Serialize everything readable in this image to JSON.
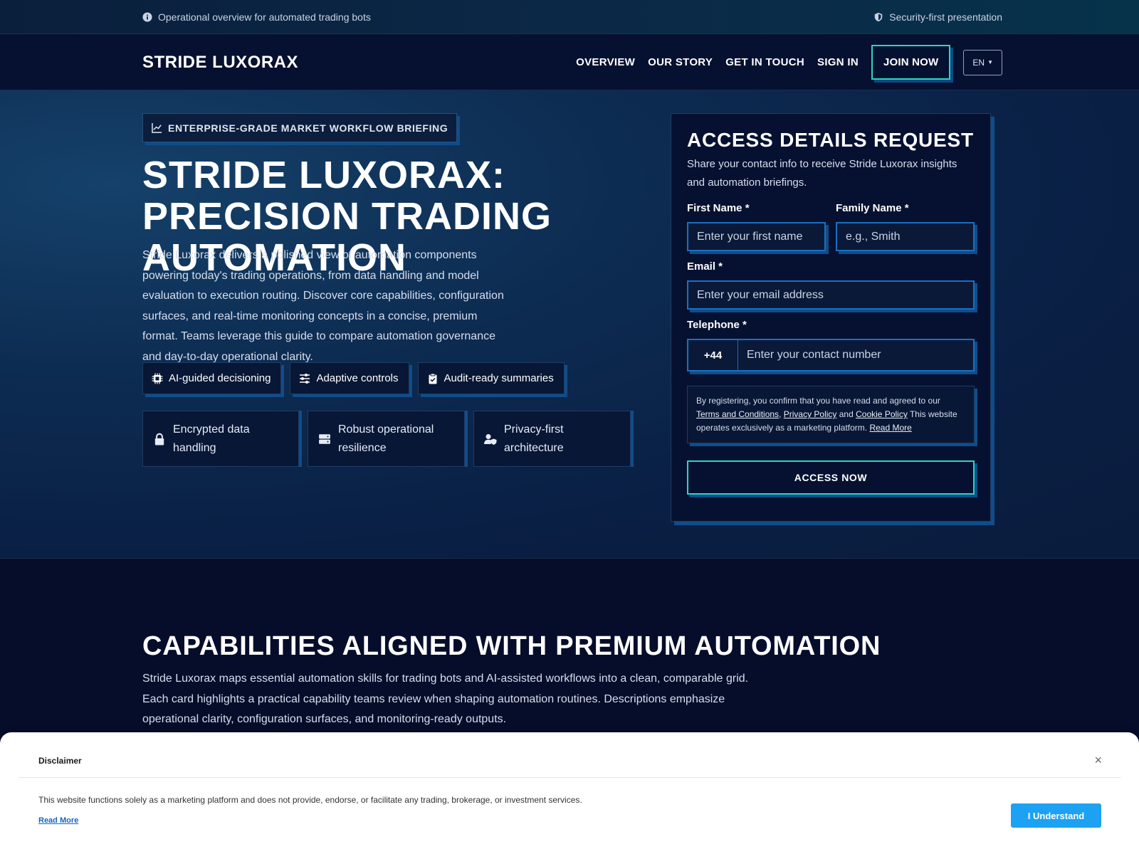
{
  "topstrip": {
    "left_text": "Operational overview for automated trading bots",
    "right_text": "Security-first presentation"
  },
  "nav": {
    "brand": "STRIDE LUXORAX",
    "items": [
      "OVERVIEW",
      "OUR STORY",
      "GET IN TOUCH",
      "SIGN IN"
    ],
    "join": "JOIN NOW",
    "language": "EN"
  },
  "hero": {
    "badge": "ENTERPRISE-GRADE MARKET WORKFLOW BRIEFING",
    "title": "STRIDE LUXORAX: PRECISION TRADING AUTOMATION",
    "lead": "Stride Luxorax delivers a polished view of automation components powering today's trading operations, from data handling and model evaluation to execution routing. Discover core capabilities, configuration surfaces, and real-time monitoring concepts in a concise, premium format. Teams leverage this guide to compare automation governance and day-to-day operational clarity.",
    "chips": [
      "AI-guided decisioning",
      "Adaptive controls",
      "Audit-ready summaries"
    ],
    "features": [
      "Encrypted data handling",
      "Robust operational resilience",
      "Privacy-first architecture"
    ]
  },
  "form": {
    "title": "ACCESS DETAILS REQUEST",
    "subtitle": "Share your contact info to receive Stride Luxorax insights and automation briefings.",
    "first_name_label": "First Name *",
    "first_name_placeholder": "Enter your first name",
    "family_name_label": "Family Name *",
    "family_name_placeholder": "e.g., Smith",
    "email_label": "Email *",
    "email_placeholder": "Enter your email address",
    "phone_label": "Telephone *",
    "phone_code": "+44",
    "phone_placeholder": "Enter your contact number",
    "legal": {
      "part1": "By registering, you confirm that you have read and agreed to our ",
      "terms": "Terms and Conditions",
      "comma": ", ",
      "privacy": "Privacy Policy",
      "and": " and ",
      "cookie": "Cookie Policy",
      "part2": " This website operates exclusively as a marketing platform. ",
      "read_more": "Read More"
    },
    "submit": "ACCESS NOW"
  },
  "capabilities": {
    "title": "CAPABILITIES ALIGNED WITH PREMIUM AUTOMATION",
    "text": "Stride Luxorax maps essential automation skills for trading bots and AI-assisted workflows into a clean, comparable grid. Each card highlights a practical capability teams review when shaping automation routines. Descriptions emphasize operational clarity, configuration surfaces, and monitoring-ready outputs."
  },
  "disclaimer": {
    "title": "Disclaimer",
    "close": "×",
    "text": "This website functions solely as a marketing platform and does not provide, endorse, or facilitate any trading, brokerage, or investment services.",
    "read_more": "Read More",
    "button": "I Understand"
  },
  "colors": {
    "accent_teal": "#2dd4bf",
    "accent_blue": "#1b6fc1",
    "page_bg": "#050d2a",
    "cta_blue": "#1da1f2"
  }
}
